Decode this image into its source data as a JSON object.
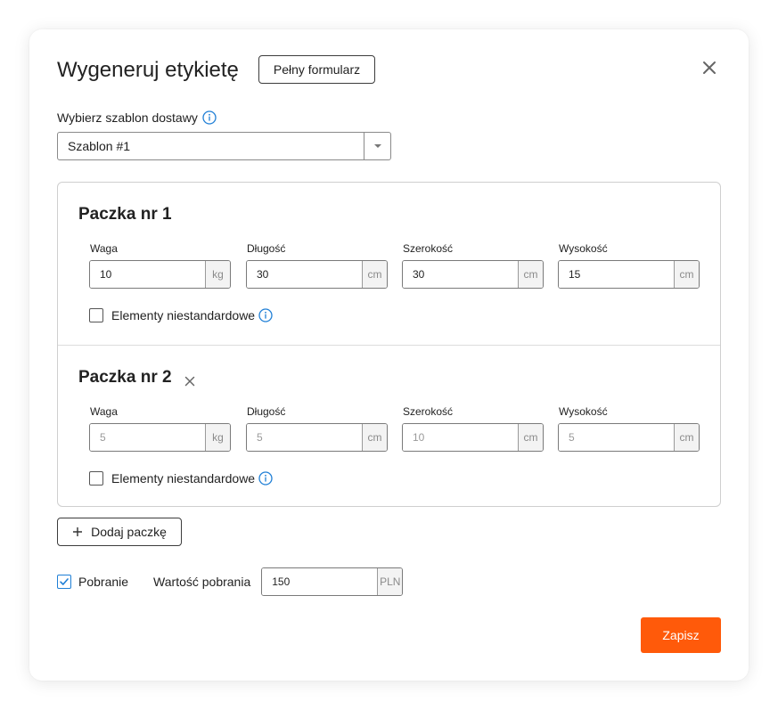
{
  "dialog": {
    "title": "Wygeneruj etykietę",
    "full_form_label": "Pełny formularz",
    "close_icon": "close-icon"
  },
  "template": {
    "label": "Wybierz szablon dostawy",
    "selected": "Szablon #1"
  },
  "packages": [
    {
      "title": "Paczka nr 1",
      "removable": false,
      "fields": [
        {
          "label": "Waga",
          "value": "10",
          "placeholder": "",
          "unit": "kg"
        },
        {
          "label": "Długość",
          "value": "30",
          "placeholder": "",
          "unit": "cm"
        },
        {
          "label": "Szerokość",
          "value": "30",
          "placeholder": "",
          "unit": "cm"
        },
        {
          "label": "Wysokość",
          "value": "15",
          "placeholder": "",
          "unit": "cm"
        }
      ],
      "nonstandard_label": "Elementy niestandardowe",
      "nonstandard_checked": false
    },
    {
      "title": "Paczka nr 2",
      "removable": true,
      "fields": [
        {
          "label": "Waga",
          "value": "",
          "placeholder": "5",
          "unit": "kg"
        },
        {
          "label": "Długość",
          "value": "",
          "placeholder": "5",
          "unit": "cm"
        },
        {
          "label": "Szerokość",
          "value": "",
          "placeholder": "10",
          "unit": "cm"
        },
        {
          "label": "Wysokość",
          "value": "",
          "placeholder": "5",
          "unit": "cm"
        }
      ],
      "nonstandard_label": "Elementy niestandardowe",
      "nonstandard_checked": false
    }
  ],
  "add_package_label": "Dodaj paczkę",
  "cod": {
    "checkbox_label": "Pobranie",
    "checked": true,
    "value_label": "Wartość pobrania",
    "value": "150",
    "currency": "PLN"
  },
  "save_label": "Zapisz",
  "colors": {
    "accent": "#ff5a0a",
    "info": "#1f7fd6"
  }
}
